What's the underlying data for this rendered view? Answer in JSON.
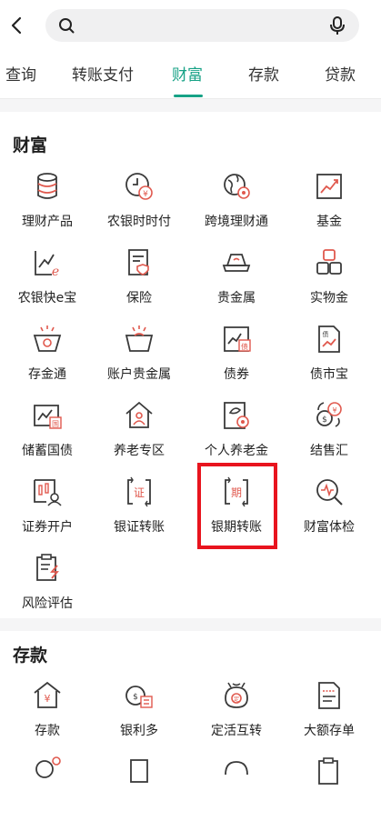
{
  "search": {
    "placeholder": ""
  },
  "tabs": [
    {
      "label": "查询",
      "active": false
    },
    {
      "label": "转账支付",
      "active": false
    },
    {
      "label": "财富",
      "active": true
    },
    {
      "label": "存款",
      "active": false
    },
    {
      "label": "贷款",
      "active": false
    }
  ],
  "wealth": {
    "title": "财富",
    "items": [
      {
        "label": "理财产品",
        "icon": "coin-stack-icon"
      },
      {
        "label": "农银时时付",
        "icon": "clock-yen-icon"
      },
      {
        "label": "跨境理财通",
        "icon": "globe-coin-icon"
      },
      {
        "label": "基金",
        "icon": "fund-chart-icon"
      },
      {
        "label": "农银快e宝",
        "icon": "chart-e-icon"
      },
      {
        "label": "保险",
        "icon": "insurance-doc-icon"
      },
      {
        "label": "贵金属",
        "icon": "gold-bar-icon"
      },
      {
        "label": "实物金",
        "icon": "gold-blocks-icon"
      },
      {
        "label": "存金通",
        "icon": "gold-basket-icon"
      },
      {
        "label": "账户贵金属",
        "icon": "account-gold-icon"
      },
      {
        "label": "债券",
        "icon": "bond-chart-icon"
      },
      {
        "label": "债市宝",
        "icon": "bond-doc-icon"
      },
      {
        "label": "储蓄国债",
        "icon": "treasury-bond-icon"
      },
      {
        "label": "养老专区",
        "icon": "pension-house-icon"
      },
      {
        "label": "个人养老金",
        "icon": "personal-pension-icon"
      },
      {
        "label": "结售汇",
        "icon": "currency-exchange-icon"
      },
      {
        "label": "证券开户",
        "icon": "securities-account-icon"
      },
      {
        "label": "银证转账",
        "icon": "bank-securities-transfer-icon"
      },
      {
        "label": "银期转账",
        "icon": "bank-futures-transfer-icon"
      },
      {
        "label": "财富体检",
        "icon": "wealth-checkup-icon"
      },
      {
        "label": "风险评估",
        "icon": "risk-assessment-icon"
      }
    ],
    "sub_glyphs": {
      "securities": "证",
      "futures": "期"
    }
  },
  "deposit": {
    "title": "存款",
    "items": [
      {
        "label": "存款",
        "icon": "deposit-house-icon"
      },
      {
        "label": "银利多",
        "icon": "yinliduo-icon"
      },
      {
        "label": "定活互转",
        "icon": "fixed-current-transfer-icon"
      },
      {
        "label": "大额存单",
        "icon": "large-cd-icon"
      }
    ]
  },
  "colors": {
    "accent": "#17a286",
    "icon_dark": "#3a3a3a",
    "icon_red": "#e0594e",
    "highlight": "#e8141e"
  }
}
